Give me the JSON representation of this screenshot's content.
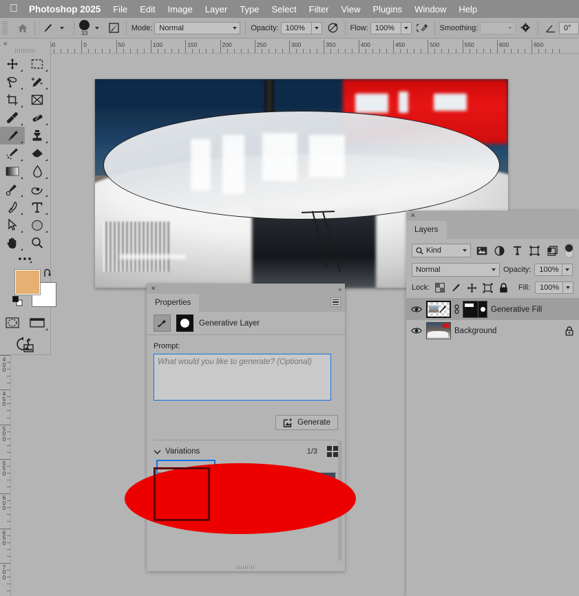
{
  "menubar": {
    "apple_icon": "apple-logo-icon",
    "app_name": "Photoshop 2025",
    "items": [
      "File",
      "Edit",
      "Image",
      "Layer",
      "Type",
      "Select",
      "Filter",
      "View",
      "Plugins",
      "Window",
      "Help"
    ]
  },
  "options_bar": {
    "home_icon": "home-icon",
    "brush_preset_icon": "brush-icon",
    "brush_size": "33",
    "brush_settings_icon": "brush-panel-icon",
    "mode_label": "Mode:",
    "mode_value": "Normal",
    "opacity_label": "Opacity:",
    "opacity_value": "100%",
    "airbrush_icon": "pressure-opacity-icon",
    "flow_label": "Flow:",
    "flow_value": "100%",
    "flow_pressure_icon": "airbrush-icon",
    "smoothing_label": "Smoothing:",
    "smoothing_value": "",
    "smoothing_options_icon": "gear-icon",
    "angle_icon": "angle-icon",
    "angle_value": "0°"
  },
  "ruler": {
    "horizontal_labels": [
      "50",
      "0",
      "50",
      "100",
      "150",
      "200",
      "250",
      "300",
      "350",
      "400",
      "450",
      "500",
      "550",
      "600",
      "650"
    ],
    "vertical_labels": [
      "400",
      "450",
      "500",
      "550",
      "600",
      "650",
      "700"
    ]
  },
  "toolbar": {
    "collapse_icon": "collapse-panel-icon",
    "tools": [
      {
        "name": "move-tool",
        "active": false
      },
      {
        "name": "rectangular-marquee-tool",
        "active": false
      },
      {
        "name": "lasso-tool",
        "active": false
      },
      {
        "name": "object-selection-tool",
        "active": false
      },
      {
        "name": "crop-tool",
        "active": false
      },
      {
        "name": "frame-tool",
        "active": false
      },
      {
        "name": "eyedropper-tool",
        "active": false
      },
      {
        "name": "spot-healing-brush-tool",
        "active": false
      },
      {
        "name": "brush-tool",
        "active": true
      },
      {
        "name": "clone-stamp-tool",
        "active": false
      },
      {
        "name": "history-brush-tool",
        "active": false
      },
      {
        "name": "eraser-tool",
        "active": false
      },
      {
        "name": "gradient-tool",
        "active": false
      },
      {
        "name": "blur-tool",
        "active": false
      },
      {
        "name": "dodge-tool",
        "active": false
      },
      {
        "name": "pen-tool-alt",
        "active": false
      },
      {
        "name": "pen-tool",
        "active": false
      },
      {
        "name": "type-tool",
        "active": false
      },
      {
        "name": "path-selection-tool",
        "active": false
      },
      {
        "name": "ellipse-shape-tool",
        "active": false
      },
      {
        "name": "hand-tool",
        "active": false
      },
      {
        "name": "zoom-tool",
        "active": false
      }
    ],
    "more_tools_icon": "more-tools-icon",
    "foreground_color": "#e5b071",
    "background_color": "#ffffff",
    "swap_colors_icon": "swap-colors-icon",
    "default_colors_icon": "default-colors-icon",
    "quick_mask_icon": "quick-mask-icon",
    "screen_mode_icon": "screen-mode-icon",
    "generative_icon": "generative-fill-icon"
  },
  "properties_panel": {
    "close_icon": "close-icon",
    "collapse_icon": "collapse-panel-icon",
    "tab_label": "Properties",
    "menu_icon": "panel-menu-icon",
    "layer_thumb_icon": "generative-layer-icon",
    "mask_thumb_icon": "layer-mask-icon",
    "layer_title": "Generative Layer",
    "prompt_label": "Prompt:",
    "prompt_placeholder": "What would you like to generate? (Optional)",
    "prompt_value": "",
    "generate_button": "Generate",
    "generate_icon": "generate-icon",
    "variations_label": "Variations",
    "variations_disclosure_icon": "chevron-down-icon",
    "variations_count": "1/3",
    "variations_grid_icon": "grid-view-icon",
    "variation_count_items": 3,
    "selected_variation_index": 0,
    "overlay_color": "#ec0000",
    "overlay_box_color": "#5e0303"
  },
  "layers_panel": {
    "close_icon": "close-icon",
    "tab_label": "Layers",
    "filter_kind_icon": "search-icon",
    "filter_kind_label": "Kind",
    "filter_icons": [
      "pixel-layer-filter-icon",
      "adjustment-layer-filter-icon",
      "type-layer-filter-icon",
      "shape-layer-filter-icon",
      "smart-object-filter-icon"
    ],
    "filter_toggle_icon": "filter-toggle-icon",
    "blend_mode": "Normal",
    "opacity_label": "Opacity:",
    "opacity_value": "100%",
    "lock_label": "Lock:",
    "lock_icons": [
      "lock-transparent-pixels-icon",
      "lock-image-pixels-icon",
      "lock-position-icon",
      "lock-artboard-icon",
      "lock-all-icon"
    ],
    "fill_label": "Fill:",
    "fill_value": "100%",
    "layers": [
      {
        "name": "Generative Fill",
        "visible": true,
        "selected": true,
        "has_mask": true,
        "locked": false,
        "eye_icon": "eye-icon",
        "link_icon": "link-icon"
      },
      {
        "name": "Background",
        "visible": true,
        "selected": false,
        "has_mask": false,
        "locked": true,
        "eye_icon": "eye-icon",
        "lock_icon": "lock-icon"
      }
    ]
  },
  "canvas": {
    "document_name": "",
    "selection_visible": true
  }
}
